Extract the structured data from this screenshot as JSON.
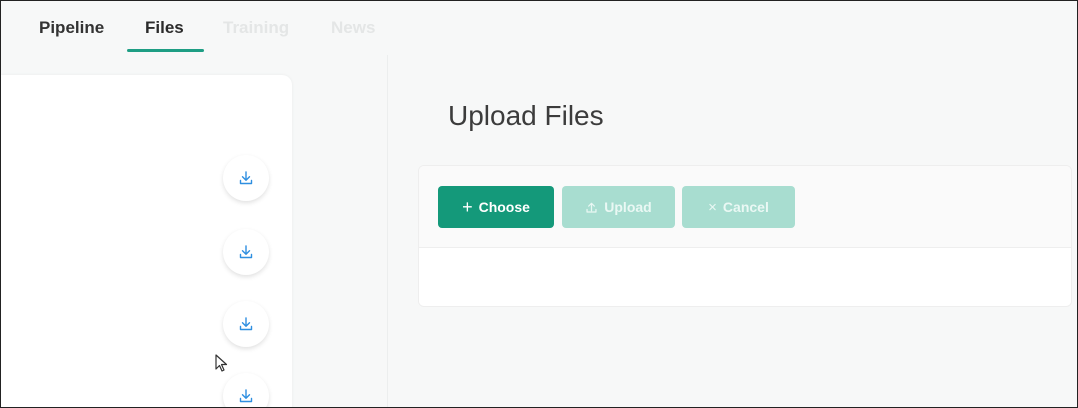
{
  "tabs": [
    {
      "label": "Pipeline",
      "active": false
    },
    {
      "label": "Files",
      "active": true
    },
    {
      "label": "Training",
      "active": false
    },
    {
      "label": "News",
      "active": false
    }
  ],
  "upload": {
    "title": "Upload Files",
    "choose_label": "Choose",
    "upload_label": "Upload",
    "cancel_label": "Cancel"
  },
  "left_panel": {
    "download_icons": [
      "download-icon",
      "download-icon",
      "download-icon",
      "download-icon"
    ]
  },
  "colors": {
    "accent": "#14997a",
    "accent_disabled": "#a8ddd0"
  }
}
